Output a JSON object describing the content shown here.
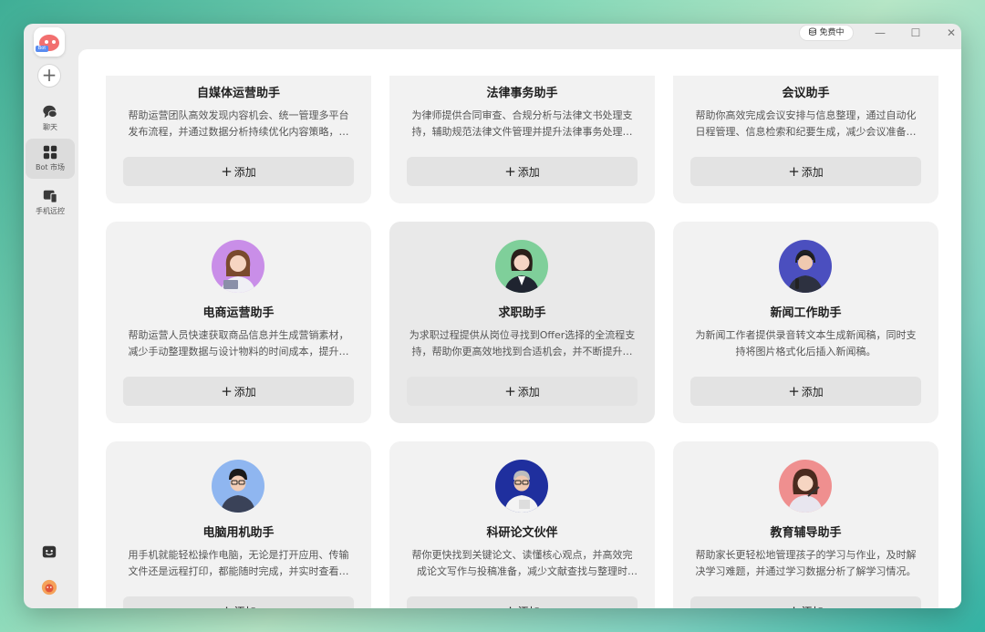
{
  "sidebar": {
    "logo_text": "Bot",
    "items": [
      {
        "label": "聊天",
        "icon": "chat-icon"
      },
      {
        "label": "Bot 市场",
        "icon": "market-grid-icon"
      },
      {
        "label": "手机远控",
        "icon": "phone-remote-icon"
      }
    ]
  },
  "topbar": {
    "plan_label": "免费中",
    "minimize": "—",
    "maximize": "☐",
    "close": "✕"
  },
  "add_label": "添加",
  "bots": [
    {
      "title": "自媒体运营助手",
      "desc": "帮助运营团队高效发现内容机会、统一管理多平台发布流程，并通过数据分析持续优化内容策略，提升传播效果。"
    },
    {
      "title": "法律事务助手",
      "desc": "为律师提供合同审查、合规分析与法律文书处理支持，辅助规范法律文件管理并提升法律事务处理效率。"
    },
    {
      "title": "会议助手",
      "desc": "帮助你高效完成会议安排与信息整理，通过自动化日程管理、信息检索和纪要生成，减少会议准备工作。"
    },
    {
      "title": "电商运营助手",
      "desc": "帮助运营人员快速获取商品信息并生成营销素材，减少手动整理数据与设计物料的时间成本，提升运营效率。"
    },
    {
      "title": "求职助手",
      "desc": "为求职过程提供从岗位寻找到Offer选择的全流程支持，帮助你更高效地找到合适机会，并不断提升竞争力。"
    },
    {
      "title": "新闻工作助手",
      "desc": "为新闻工作者提供录音转文本生成新闻稿，同时支持将图片格式化后插入新闻稿。"
    },
    {
      "title": "电脑用机助手",
      "desc": "用手机就能轻松操作电脑，无论是打开应用、传输文件还是远程打印，都能随时完成，并实时查看执行结果。"
    },
    {
      "title": "科研论文伙伴",
      "desc": "帮你更快找到关键论文、读懂核心观点，并高效完成论文写作与投稿准备，减少文献查找与整理时间。"
    },
    {
      "title": "教育辅导助手",
      "desc": "帮助家长更轻松地管理孩子的学习与作业，及时解决学习难题，并通过学习数据分析了解学习情况。"
    }
  ],
  "colors": {
    "avatar_ecommerce": "#c98ee8",
    "avatar_job": "#7fcf9a",
    "avatar_news": "#4b4fbf",
    "avatar_computer": "#8fb6f0",
    "avatar_research": "#1f2f9e",
    "avatar_education": "#ef8f8f"
  }
}
